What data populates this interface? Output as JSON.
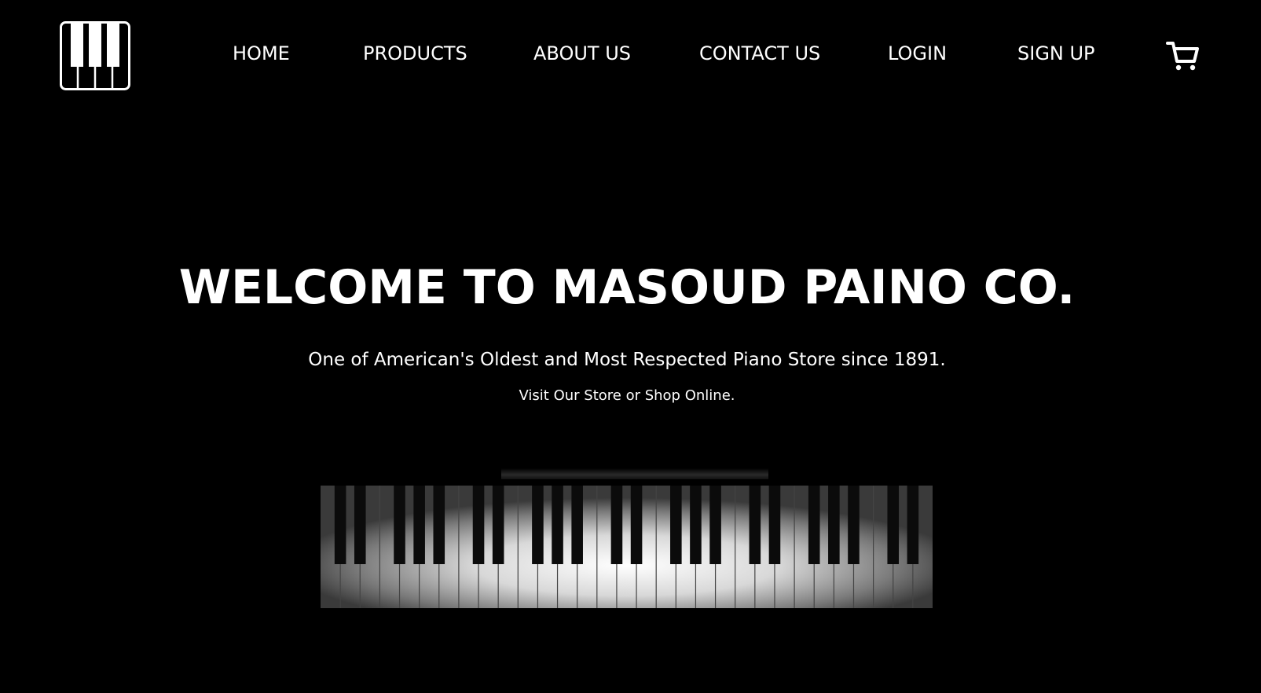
{
  "header": {
    "logo_icon": "piano-keys-icon",
    "nav": [
      {
        "label": "HOME"
      },
      {
        "label": "PRODUCTS"
      },
      {
        "label": "ABOUT US"
      },
      {
        "label": "CONTACT US"
      },
      {
        "label": "LOGIN"
      },
      {
        "label": "SIGN UP"
      }
    ],
    "cart_icon": "shopping-cart-icon"
  },
  "hero": {
    "title": "WELCOME TO MASOUD PAINO CO.",
    "subtitle": "One of American's Oldest and Most Respected Piano Store since 1891.",
    "tagline": "Visit Our Store or Shop Online.",
    "image_icon": "piano-keyboard-image"
  },
  "colors": {
    "background": "#000000",
    "text": "#ffffff"
  }
}
